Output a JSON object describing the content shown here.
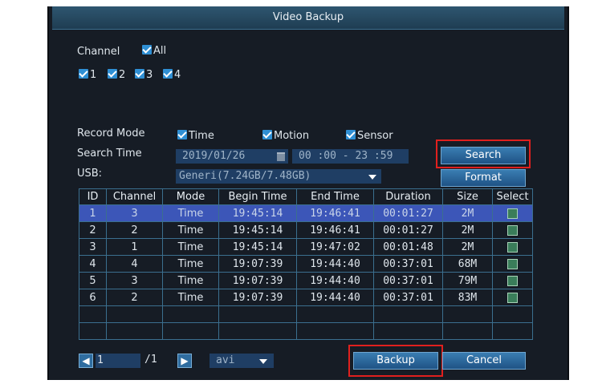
{
  "window": {
    "title": "Video Backup"
  },
  "channel": {
    "label": "Channel",
    "all_label": "All",
    "all_checked": true,
    "items": [
      {
        "label": "1",
        "checked": true
      },
      {
        "label": "2",
        "checked": true
      },
      {
        "label": "3",
        "checked": true
      },
      {
        "label": "4",
        "checked": true
      }
    ]
  },
  "record_mode": {
    "label": "Record Mode",
    "options": [
      {
        "label": "Time",
        "checked": true
      },
      {
        "label": "Motion",
        "checked": true
      },
      {
        "label": "Sensor",
        "checked": true
      }
    ]
  },
  "search_time": {
    "label": "Search Time",
    "date": "2019/01/26",
    "time_range": "00 :00 - 23 :59"
  },
  "usb": {
    "label": "USB:",
    "device": "Generi(7.24GB/7.48GB)"
  },
  "buttons": {
    "search": "Search",
    "format": "Format",
    "backup": "Backup",
    "cancel": "Cancel"
  },
  "table": {
    "columns": [
      "ID",
      "Channel",
      "Mode",
      "Begin Time",
      "End Time",
      "Duration",
      "Size",
      "Select"
    ],
    "rows": [
      {
        "id": "1",
        "channel": "3",
        "mode": "Time",
        "begin": "19:45:14",
        "end": "19:46:41",
        "duration": "00:01:27",
        "size": "2M"
      },
      {
        "id": "2",
        "channel": "2",
        "mode": "Time",
        "begin": "19:45:14",
        "end": "19:46:41",
        "duration": "00:01:27",
        "size": "2M"
      },
      {
        "id": "3",
        "channel": "1",
        "mode": "Time",
        "begin": "19:45:14",
        "end": "19:47:02",
        "duration": "00:01:48",
        "size": "2M"
      },
      {
        "id": "4",
        "channel": "4",
        "mode": "Time",
        "begin": "19:07:39",
        "end": "19:44:40",
        "duration": "00:37:01",
        "size": "68M"
      },
      {
        "id": "5",
        "channel": "3",
        "mode": "Time",
        "begin": "19:07:39",
        "end": "19:44:40",
        "duration": "00:37:01",
        "size": "79M"
      },
      {
        "id": "6",
        "channel": "2",
        "mode": "Time",
        "begin": "19:07:39",
        "end": "19:44:40",
        "duration": "00:37:01",
        "size": "83M"
      }
    ],
    "selected_row": 1
  },
  "pager": {
    "page": "1",
    "total": "/1",
    "format": "avi"
  },
  "colors": {
    "highlight": "#e0201e",
    "row_selected": "#3c56b8",
    "accent": "#2f8fd4"
  }
}
